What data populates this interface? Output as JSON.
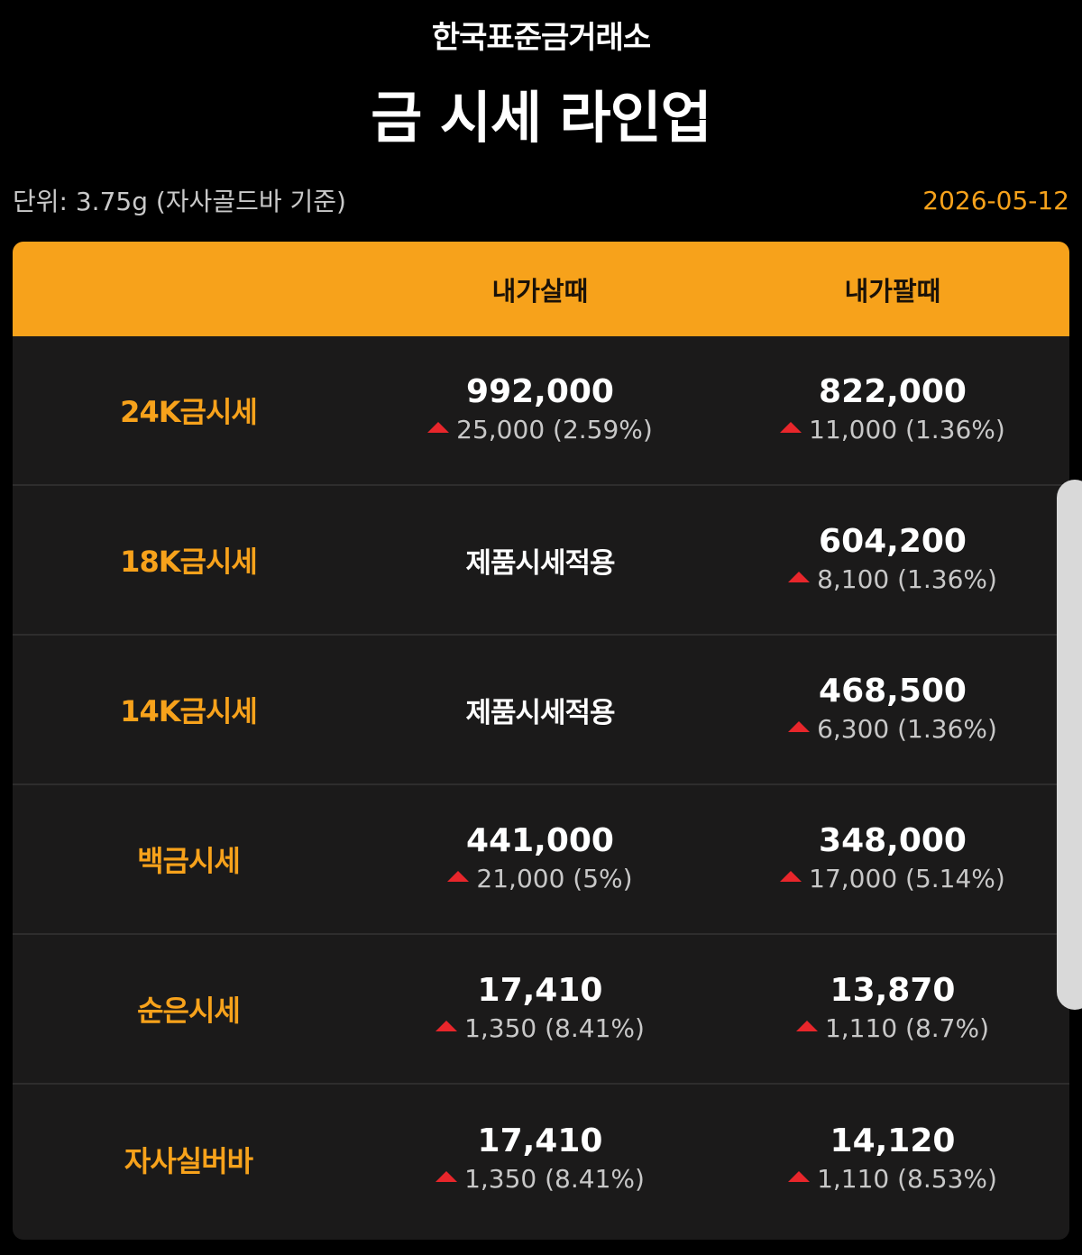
{
  "header": {
    "brand": "한국표준금거래소",
    "title": "금 시세 라인업"
  },
  "meta": {
    "unit_note": "단위: 3.75g (자사골드바 기준)",
    "date": "2026-05-12"
  },
  "table": {
    "columns": [
      "",
      "내가살때",
      "내가팔때"
    ],
    "rows": [
      {
        "label": "24K금시세",
        "buy": {
          "price": "992,000",
          "change": "25,000 (2.59%)",
          "text": ""
        },
        "sell": {
          "price": "822,000",
          "change": "11,000 (1.36%)"
        }
      },
      {
        "label": "18K금시세",
        "buy": {
          "price": "",
          "change": "",
          "text": "제품시세적용"
        },
        "sell": {
          "price": "604,200",
          "change": "8,100 (1.36%)"
        }
      },
      {
        "label": "14K금시세",
        "buy": {
          "price": "",
          "change": "",
          "text": "제품시세적용"
        },
        "sell": {
          "price": "468,500",
          "change": "6,300 (1.36%)"
        }
      },
      {
        "label": "백금시세",
        "buy": {
          "price": "441,000",
          "change": "21,000 (5%)",
          "text": ""
        },
        "sell": {
          "price": "348,000",
          "change": "17,000 (5.14%)"
        }
      },
      {
        "label": "순은시세",
        "buy": {
          "price": "17,410",
          "change": "1,350 (8.41%)",
          "text": ""
        },
        "sell": {
          "price": "13,870",
          "change": "1,110 (8.7%)"
        }
      },
      {
        "label": "자사실버바",
        "buy": {
          "price": "17,410",
          "change": "1,350 (8.41%)",
          "text": ""
        },
        "sell": {
          "price": "14,120",
          "change": "1,110 (8.53%)"
        }
      }
    ]
  },
  "colors": {
    "accent": "#f7a21b",
    "up": "#e8262b",
    "background": "#000000",
    "panel": "#1b1a1a"
  },
  "icons": {
    "change_direction": "triangle-up-icon"
  }
}
